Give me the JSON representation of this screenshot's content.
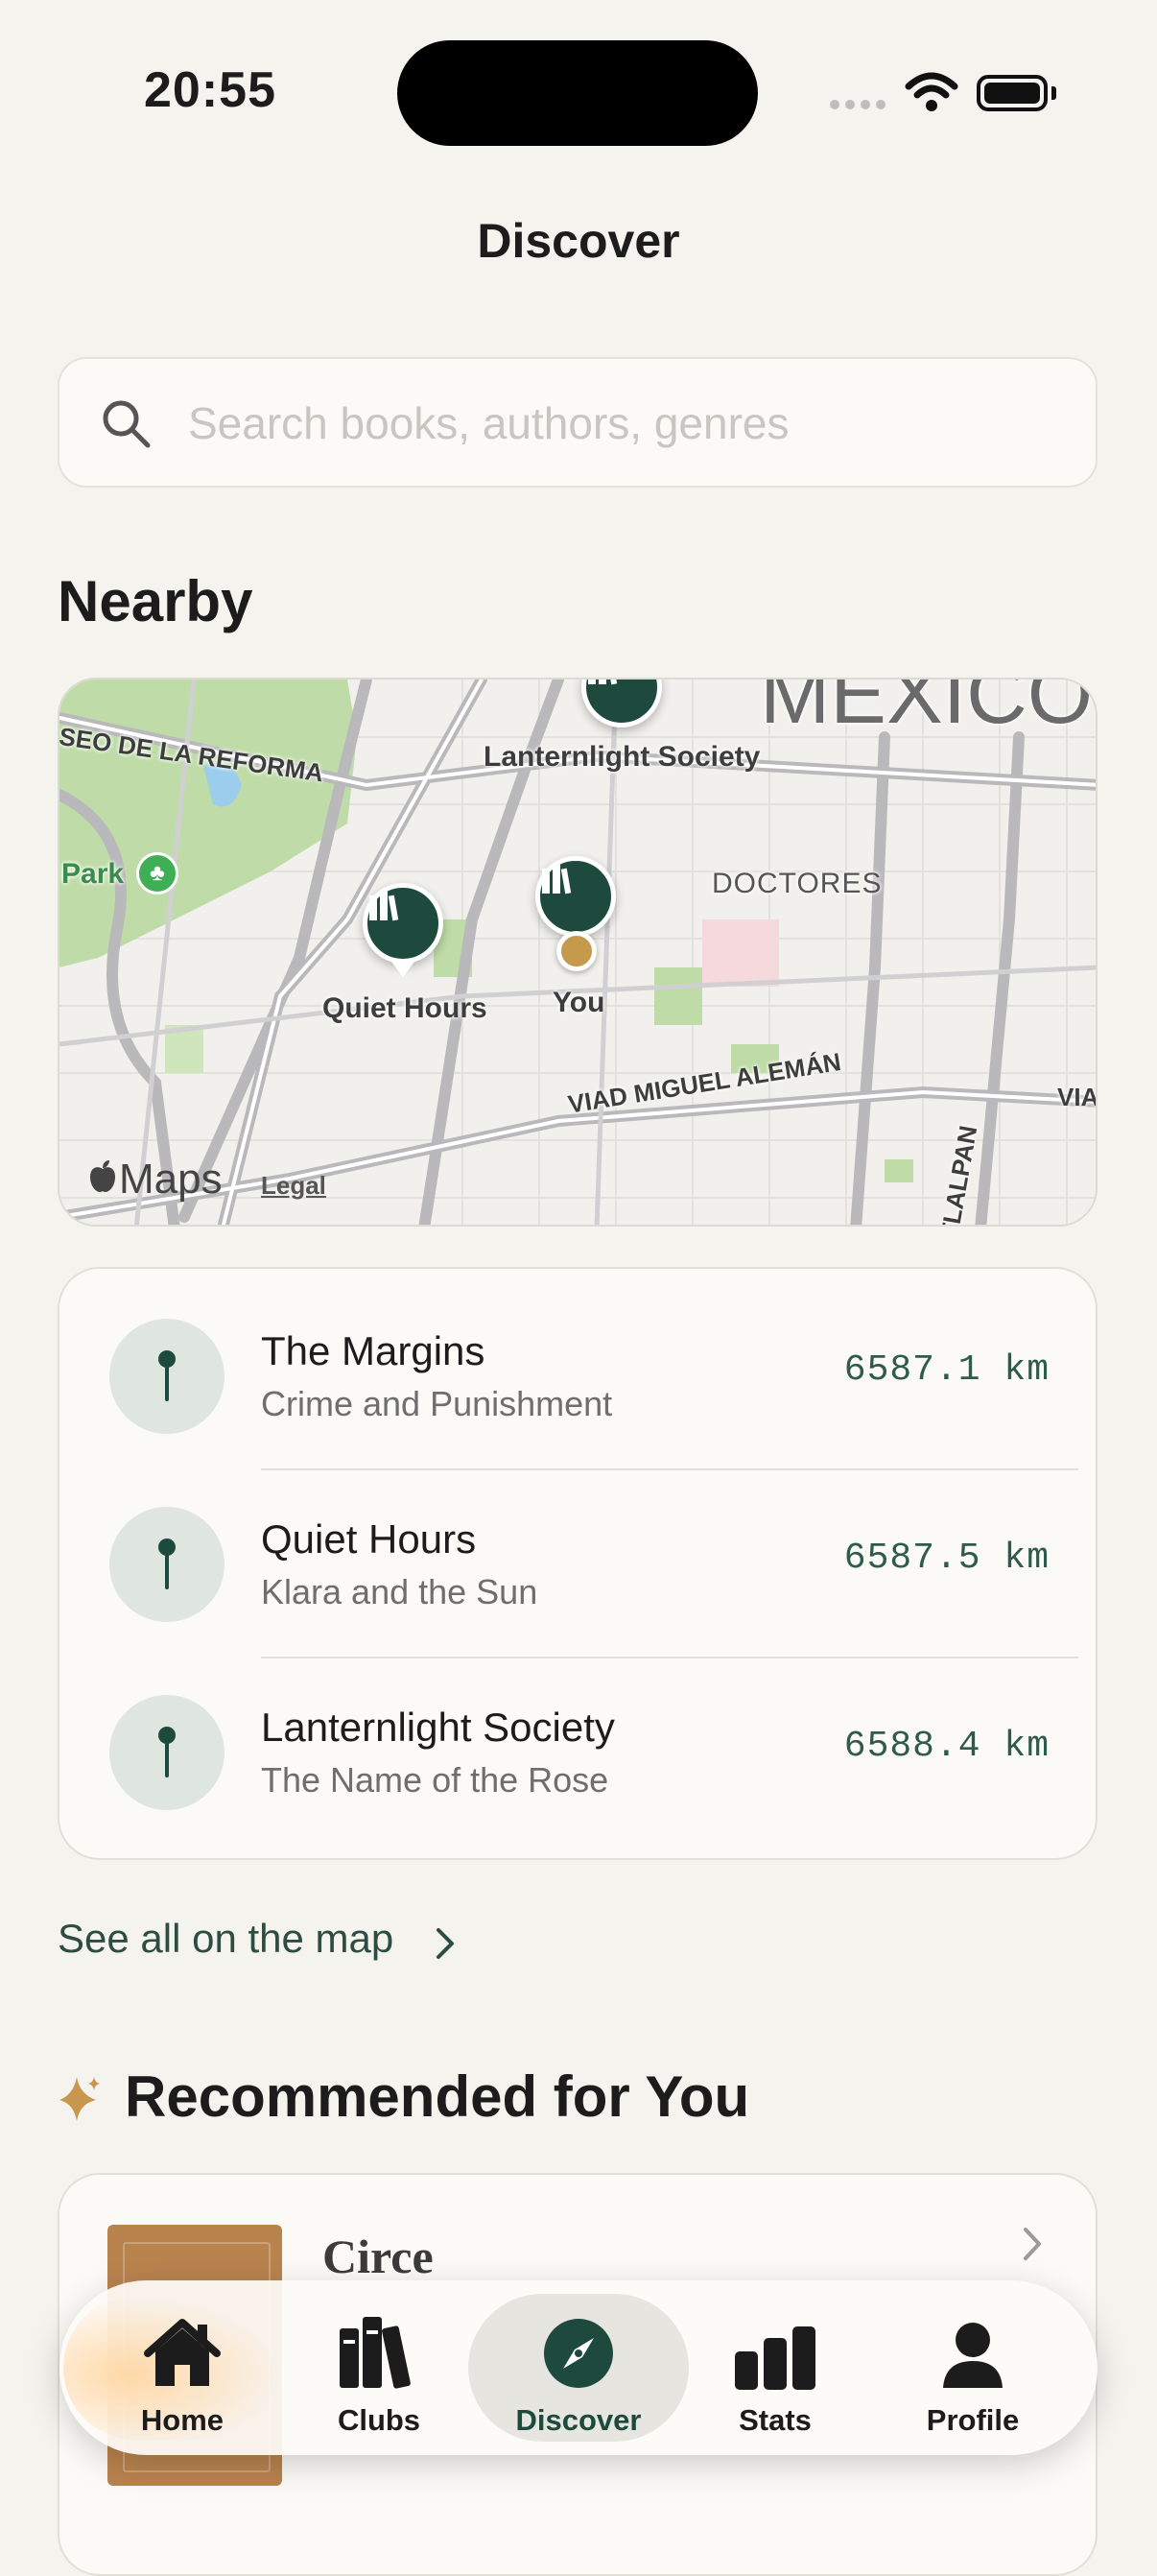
{
  "status_bar": {
    "time": "20:55"
  },
  "header": {
    "title": "Discover"
  },
  "search": {
    "placeholder": "Search books, authors, genres",
    "value": ""
  },
  "nearby": {
    "heading": "Nearby",
    "map": {
      "street_labels": [
        "SEO DE LA REFORMA",
        "VIAD MIGUEL ALEMÁN",
        "VIA",
        "TLALPAN"
      ],
      "area_labels": [
        "Park",
        "DOCTORES",
        "México"
      ],
      "pins": [
        {
          "label": "Lanternlight Society",
          "icon": "books-icon"
        },
        {
          "label": "Quiet Hours",
          "icon": "books-icon"
        },
        {
          "label": "",
          "icon": "books-icon"
        }
      ],
      "you_label": "You",
      "attribution": "Maps",
      "legal": "Legal"
    },
    "items": [
      {
        "name": "The Margins",
        "book": "Crime and Punishment",
        "distance": "6587.1 km",
        "icon": "pin-icon"
      },
      {
        "name": "Quiet Hours",
        "book": "Klara and the Sun",
        "distance": "6587.5 km",
        "icon": "pin-icon"
      },
      {
        "name": "Lanternlight Society",
        "book": "The Name of the Rose",
        "distance": "6588.4 km",
        "icon": "pin-icon"
      }
    ],
    "see_all": "See all on the map"
  },
  "recommended": {
    "heading": "Recommended for You",
    "icon": "sparkle-icon",
    "items": [
      {
        "title": "Circe"
      }
    ]
  },
  "tabs": [
    {
      "label": "Home",
      "icon": "house-icon"
    },
    {
      "label": "Clubs",
      "icon": "books-icon"
    },
    {
      "label": "Discover",
      "icon": "compass-icon",
      "selected": true
    },
    {
      "label": "Stats",
      "icon": "bar-chart-icon"
    },
    {
      "label": "Profile",
      "icon": "person-icon"
    }
  ],
  "colors": {
    "accent": "#1e4a3e",
    "background": "#f5f3ee",
    "distance_text": "#2f5a4c",
    "sparkle": "#c9964f"
  }
}
